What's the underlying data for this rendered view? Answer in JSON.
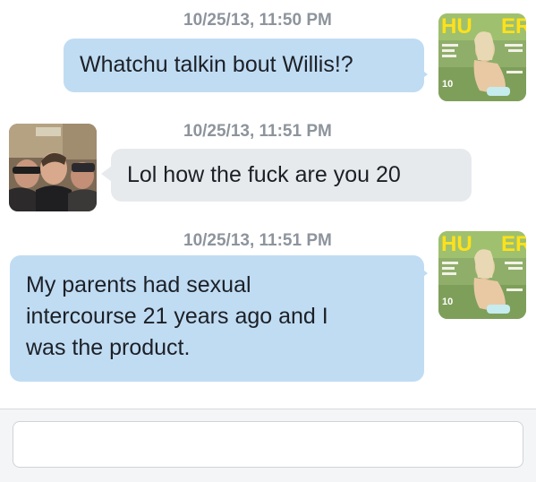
{
  "conversation": {
    "messages": [
      {
        "timestamp": "10/25/13, 11:50 PM",
        "direction": "sent",
        "lines": [
          "Whatchu talkin bout Willis!?"
        ],
        "avatar": "magazine-cover-avatar"
      },
      {
        "timestamp": "10/25/13, 11:51 PM",
        "direction": "received",
        "lines": [
          "Lol how the fuck are you 20"
        ],
        "avatar": "group-photo-avatar"
      },
      {
        "timestamp": "10/25/13, 11:51 PM",
        "direction": "sent",
        "lines": [
          "My parents had sexual",
          "intercourse 21 years ago and I",
          "was the product."
        ],
        "avatar": "magazine-cover-avatar"
      }
    ]
  },
  "composer": {
    "value": "",
    "placeholder": ""
  },
  "colors": {
    "sent_bubble": "#c0dcf3",
    "received_bubble": "#e7eaed",
    "timestamp": "#8d949c",
    "text": "#1c2026",
    "composer_bar": "#f4f5f7"
  }
}
